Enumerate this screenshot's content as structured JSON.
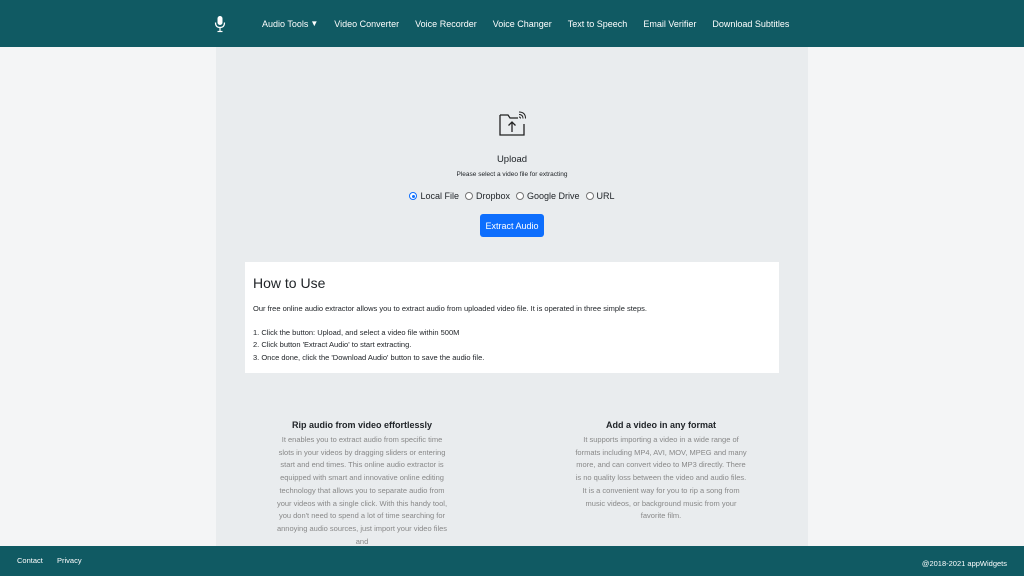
{
  "nav": {
    "logo_icon": "microphone-icon",
    "items": [
      {
        "label": "Audio Tools",
        "dropdown": true
      },
      {
        "label": "Video Converter"
      },
      {
        "label": "Voice Recorder"
      },
      {
        "label": "Voice Changer"
      },
      {
        "label": "Text to Speech"
      },
      {
        "label": "Email Verifier"
      },
      {
        "label": "Download Subtitles"
      }
    ]
  },
  "upload": {
    "icon": "upload-folder-icon",
    "title": "Upload",
    "subtitle": "Please select a video file for extracting",
    "sources": [
      {
        "label": "Local File",
        "checked": true
      },
      {
        "label": "Dropbox",
        "checked": false
      },
      {
        "label": "Google Drive",
        "checked": false
      },
      {
        "label": "URL",
        "checked": false
      }
    ],
    "button_label": "Extract Audio"
  },
  "howto": {
    "title": "How to Use",
    "intro": "Our free online audio extractor allows you to extract audio from uploaded video file. It is operated in three simple steps.",
    "steps": [
      "1. Click the button: Upload, and select a video file within 500M",
      "2. Click button 'Extract Audio' to start extracting.",
      "3. Once done, click the 'Download Audio' button to save the audio file."
    ]
  },
  "features": [
    {
      "title": "Rip audio from video effortlessly",
      "text": "It enables you to extract audio from specific time slots in your videos by dragging sliders or entering start and end times. This online audio extractor is equipped with smart and innovative online editing technology that allows you to separate audio from your videos with a single click. With this handy tool, you don't need to spend a lot of time searching for annoying audio sources, just import your video files and"
    },
    {
      "title": "Add a video in any format",
      "text": "It supports importing a video in a wide range of formats including MP4, AVI, MOV, MPEG and many more, and can convert video to MP3 directly. There is no quality loss between the video and audio files. It is a convenient way for you to rip a song from music videos, or background music from your favorite film."
    }
  ],
  "footer": {
    "contact": "Contact",
    "privacy": "Privacy",
    "copyright": "@2018-2021 appWidgets"
  },
  "colors": {
    "nav_bg": "#105a63",
    "button_bg": "#0d6efd"
  }
}
